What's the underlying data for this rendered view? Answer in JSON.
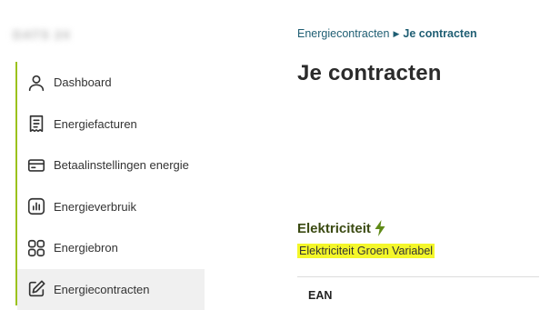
{
  "user": {
    "name": "DATS 24"
  },
  "sidebar": {
    "items": [
      {
        "label": "Dashboard",
        "icon": "user-icon"
      },
      {
        "label": "Energiefacturen",
        "icon": "receipt-icon"
      },
      {
        "label": "Betaalinstellingen energie",
        "icon": "credit-card-icon"
      },
      {
        "label": "Energieverbruik",
        "icon": "bar-chart-icon"
      },
      {
        "label": "Energiebron",
        "icon": "grid-icon"
      },
      {
        "label": "Energiecontracten",
        "icon": "edit-icon",
        "active": true
      }
    ]
  },
  "breadcrumb": {
    "parent": "Energiecontracten",
    "current": "Je contracten"
  },
  "page": {
    "title": "Je contracten"
  },
  "section": {
    "title": "Elektriciteit",
    "icon": "lightning-bolt-icon",
    "contract_name": "Elektriciteit Groen Variabel",
    "ean_label": "EAN"
  },
  "colors": {
    "accent": "#9bc21d",
    "link": "#1f5e73",
    "highlight": "#f4f72a"
  }
}
